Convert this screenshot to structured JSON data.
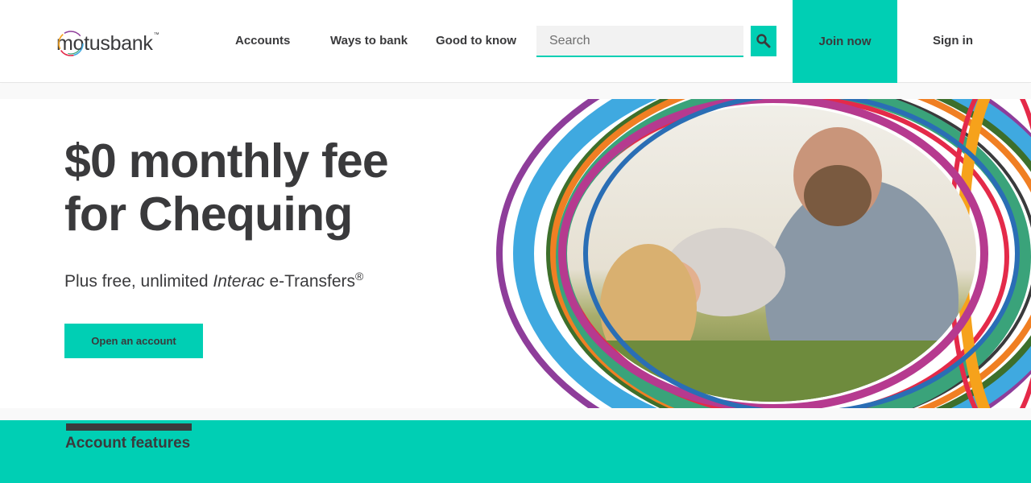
{
  "header": {
    "logo": {
      "text_light": "motus",
      "text_bold": "bank",
      "mark": "™"
    },
    "nav": [
      {
        "label": "Accounts"
      },
      {
        "label": "Ways to bank"
      },
      {
        "label": "Good to know"
      }
    ],
    "search": {
      "placeholder": "Search",
      "value": "",
      "icon": "search-icon"
    },
    "join_label": "Join now",
    "signin_label": "Sign in"
  },
  "hero": {
    "title_line1": "$0 monthly fee",
    "title_line2": "for Chequing",
    "subtitle_prefix": "Plus free, unlimited ",
    "subtitle_italic": "Interac",
    "subtitle_suffix": " e-Transfers",
    "subtitle_mark": "®",
    "cta_label": "Open an account"
  },
  "features": {
    "title": "Account features"
  },
  "colors": {
    "accent": "#00cfb4",
    "text": "#3a3a3c",
    "ring_colors": [
      "#8e3d9a",
      "#3fa9e0",
      "#3aa37a",
      "#f07f23",
      "#e42a49",
      "#b63a8f",
      "#2a6eb5",
      "#f6a21b"
    ]
  }
}
